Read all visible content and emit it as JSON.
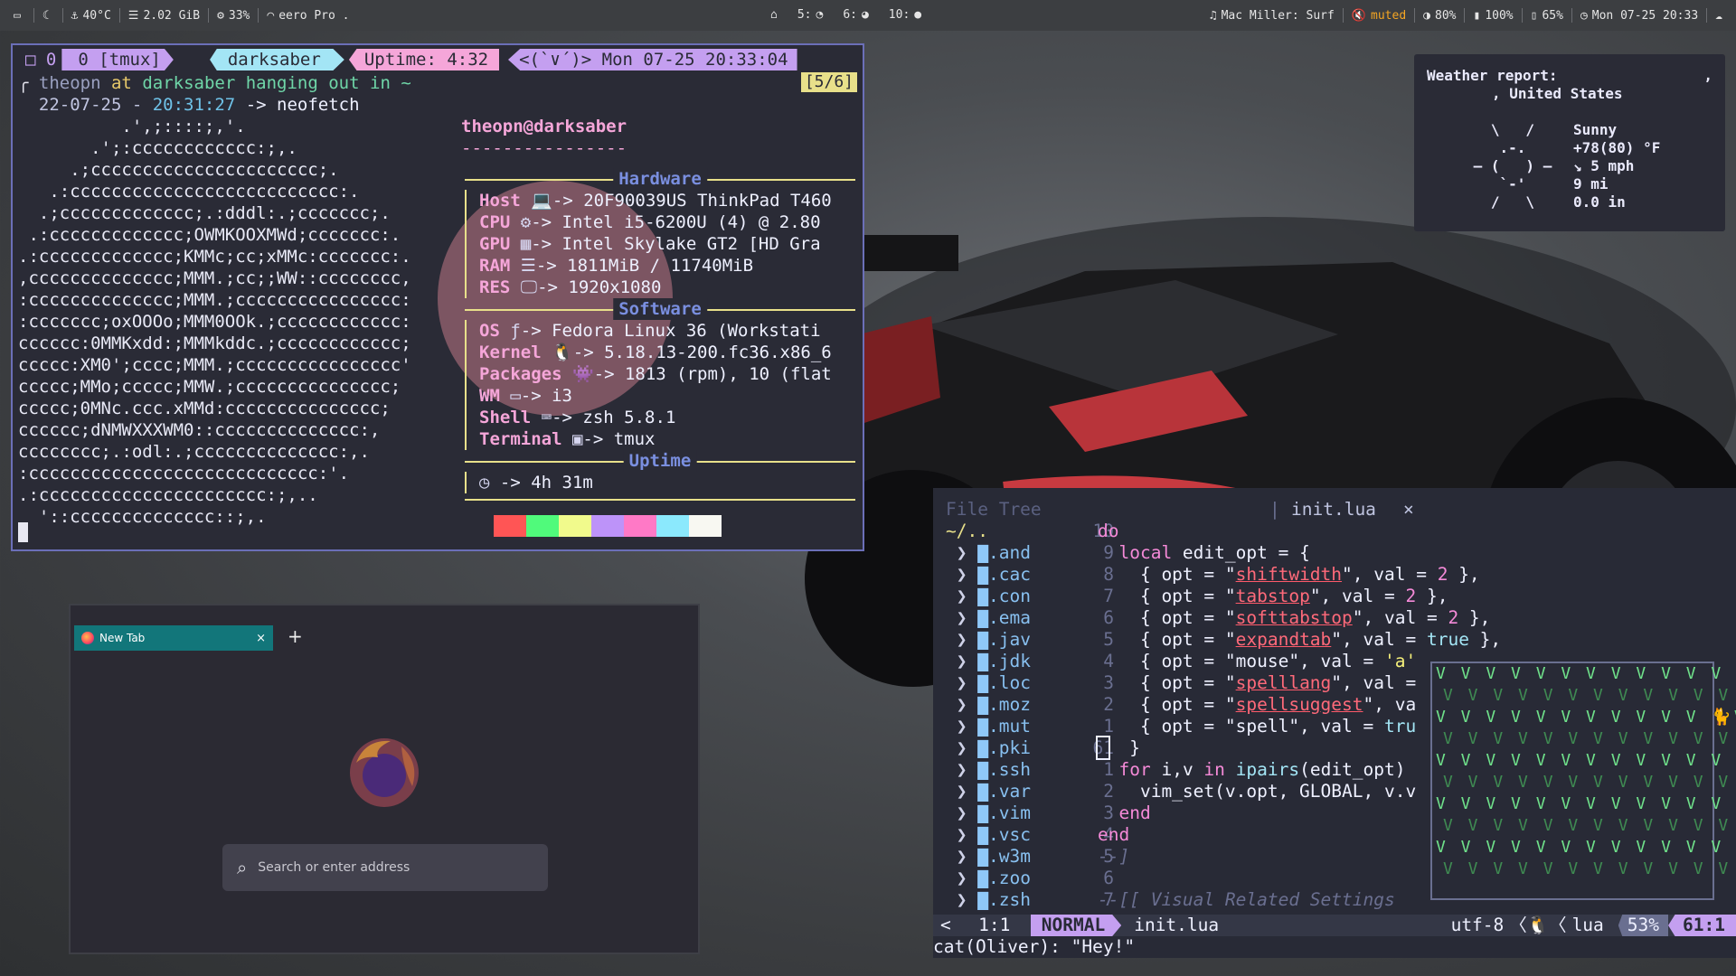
{
  "topbar": {
    "left": [
      {
        "icon": "monitor-icon",
        "text": ""
      },
      {
        "icon": "moon-icon",
        "text": ""
      },
      {
        "icon": "thermometer-icon",
        "text": "40°C"
      },
      {
        "icon": "memory-icon",
        "text": "2.02 GiB"
      },
      {
        "icon": "cpu-icon",
        "text": "33%"
      },
      {
        "icon": "wifi-icon",
        "text": "eero Pro ."
      }
    ],
    "workspaces": [
      {
        "icon": "home-icon",
        "label": ""
      },
      {
        "label": "5:",
        "icon": "clock-icon"
      },
      {
        "label": "6:",
        "icon": "browser-icon"
      },
      {
        "label": "10:",
        "icon": "chat-icon"
      }
    ],
    "music": "Mac Miller: Surf",
    "volume": "muted",
    "brightness": "80%",
    "battery1": "100%",
    "battery2": "65%",
    "datetime": "Mon 07-25 20:33"
  },
  "tmux": {
    "pane": "0",
    "window": "0 [tmux]",
    "host": "darksaber",
    "uptime_label": "Uptime:",
    "uptime": "4:32",
    "face": "<(`∨´)>",
    "date": "Mon 07-25",
    "time": "20:33:04",
    "badge": "[5/6]",
    "prompt_user": "theopn",
    "prompt_at": "at",
    "prompt_host": "darksaber",
    "prompt_hang": "hanging out in ~",
    "prompt_date": "22-07-25 -",
    "prompt_time": "20:31:27",
    "prompt_cmd": "-> neofetch",
    "ascii": "          .',;::::;,'.\n       .';:cccccccccccc:;,.\n     .;cccccccccccccccccccccc;.\n   .:cccccccccccccccccccccccccc:.\n  .;ccccccccccccc;.:dddl:.;ccccccc;.\n .:ccccccccccccc;OWMKOOXMWd;ccccccc:.\n.:ccccccccccccc;KMMc;cc;xMMc:ccccccc:.\n,cccccccccccccc;MMM.;cc;;WW::cccccccc,\n:cccccccccccccc;MMM.;cccccccccccccccc:\n:ccccccc;oxOOOo;MMM0OOk.;cccccccccccc:\ncccccc:0MMKxdd:;MMMkddc.;cccccccccccc;\nccccc:XM0';cccc;MMM.;cccccccccccccccc'\nccccc;MMo;ccccc;MMW.;ccccccccccccccc;\nccccc;0MNc.ccc.xMMd:ccccccccccccccc;\ncccccc;dNMWXXXWM0::cccccccccccccc:,\ncccccccc;.:odl:.;cccccccccccccc:,.\n:cccccccccccccccccccccccccccc:'.\n.:cccccccccccccccccccccc:;,..\n  '::cccccccccccccc::;,.",
    "nf_title": "theopn@darksaber",
    "nf_sep": "----------------",
    "hardware_label": "Hardware",
    "software_label": "Software",
    "uptime_section_label": "Uptime",
    "hardware": [
      {
        "key": "Host",
        "icon": "laptop-icon",
        "glyph": "💻",
        "val": "-> 20F90039US ThinkPad T460"
      },
      {
        "key": "CPU",
        "icon": "chip-icon",
        "glyph": "⚙",
        "val": "-> Intel i5-6200U (4) @ 2.80"
      },
      {
        "key": "GPU",
        "icon": "gpu-icon",
        "glyph": "▦",
        "val": "-> Intel Skylake GT2 [HD Gra"
      },
      {
        "key": "RAM",
        "icon": "ram-icon",
        "glyph": "☰",
        "val": "-> 1811MiB / 11740MiB"
      },
      {
        "key": "RES",
        "icon": "display-icon",
        "glyph": "🖵",
        "val": "-> 1920x1080"
      }
    ],
    "software": [
      {
        "key": "OS",
        "icon": "fedora-icon",
        "glyph": "ƒ",
        "val": "-> Fedora Linux 36 (Workstati"
      },
      {
        "key": "Kernel",
        "icon": "tux-icon",
        "glyph": "🐧",
        "val": "-> 5.18.13-200.fc36.x86_6"
      },
      {
        "key": "Packages",
        "icon": "package-icon",
        "glyph": "👾",
        "val": "-> 1813 (rpm), 10 (flat"
      },
      {
        "key": "WM",
        "icon": "window-icon",
        "glyph": "▭",
        "val": "-> i3"
      },
      {
        "key": "Shell",
        "icon": "shell-icon",
        "glyph": "⌨",
        "val": "-> zsh 5.8.1"
      },
      {
        "key": "Terminal",
        "icon": "terminal-icon",
        "glyph": "▣",
        "val": "-> tmux"
      }
    ],
    "uptime_row": {
      "icon": "clock-icon",
      "glyph": "◷",
      "val": "-> 4h 31m"
    },
    "colors": [
      "#2a2b36",
      "#ff5555",
      "#50fa7b",
      "#f1fa8c",
      "#bd93f9",
      "#ff79c6",
      "#8be9fd",
      "#f8f8f2"
    ]
  },
  "weather": {
    "title": "Weather report:",
    "comma": ",",
    "location": ", United States",
    "art": "   \\   /  \n    .-.   \n ‒ (   ) ‒\n    `-'   \n   /   \\  ",
    "condition": "Sunny",
    "temp": "+78(80) °F",
    "wind": "↘ 5 mph",
    "visibility": "9 mi",
    "precip": "0.0 in"
  },
  "firefox": {
    "tab_title": "New Tab",
    "tab_close": "×",
    "new_tab": "+",
    "search_placeholder": "Search or enter address"
  },
  "nvim": {
    "tree_title": "File Tree",
    "sep": "|",
    "buffer": "init.lua",
    "buffer_close": "×",
    "tree_root": "~/..",
    "tree": [
      ".and",
      ".cac",
      ".con",
      ".ema",
      ".jav",
      ".jdk",
      ".loc",
      ".moz",
      ".mut",
      ".pki",
      ".ssh",
      ".var",
      ".vim",
      ".vsc",
      ".w3m",
      ".zoo",
      ".zsh"
    ],
    "gutter": [
      "10",
      "9",
      "8",
      "7",
      "6",
      "5",
      "4",
      "3",
      "2",
      "1",
      "61",
      "1",
      "2",
      "3",
      "4",
      "5",
      "6",
      "7"
    ],
    "code": [
      [
        {
          "c": "kw",
          "t": "do"
        }
      ],
      [
        {
          "c": "",
          "t": "  "
        },
        {
          "c": "kw",
          "t": "local"
        },
        {
          "c": "",
          "t": " edit_opt = {"
        }
      ],
      [
        {
          "c": "",
          "t": "    { opt = \""
        },
        {
          "c": "ul",
          "t": "shiftwidth"
        },
        {
          "c": "",
          "t": "\", val = "
        },
        {
          "c": "num",
          "t": "2"
        },
        {
          "c": "",
          "t": " },"
        }
      ],
      [
        {
          "c": "",
          "t": "    { opt = \""
        },
        {
          "c": "ul",
          "t": "tabstop"
        },
        {
          "c": "",
          "t": "\", val = "
        },
        {
          "c": "num",
          "t": "2"
        },
        {
          "c": "",
          "t": " },"
        }
      ],
      [
        {
          "c": "",
          "t": "    { opt = \""
        },
        {
          "c": "ul",
          "t": "softtabstop"
        },
        {
          "c": "",
          "t": "\", val = "
        },
        {
          "c": "num",
          "t": "2"
        },
        {
          "c": "",
          "t": " },"
        }
      ],
      [
        {
          "c": "",
          "t": "    { opt = \""
        },
        {
          "c": "ul",
          "t": "expandtab"
        },
        {
          "c": "",
          "t": "\", val = "
        },
        {
          "c": "bool",
          "t": "true"
        },
        {
          "c": "",
          "t": " },"
        }
      ],
      [
        {
          "c": "",
          "t": "    { opt = \"mouse\", val = "
        },
        {
          "c": "str",
          "t": "'a'"
        }
      ],
      [
        {
          "c": "",
          "t": "    { opt = \""
        },
        {
          "c": "ul",
          "t": "spelllang"
        },
        {
          "c": "",
          "t": "\", val ="
        }
      ],
      [
        {
          "c": "",
          "t": "    { opt = \""
        },
        {
          "c": "ul",
          "t": "spellsuggest"
        },
        {
          "c": "",
          "t": "\", va"
        }
      ],
      [
        {
          "c": "",
          "t": "    { opt = \"spell\", val = "
        },
        {
          "c": "bool",
          "t": "tru"
        }
      ],
      [
        {
          "c": "",
          "t": "  }"
        }
      ],
      [
        {
          "c": "",
          "t": "  "
        },
        {
          "c": "kw",
          "t": "for"
        },
        {
          "c": "",
          "t": " i,v "
        },
        {
          "c": "kw",
          "t": "in"
        },
        {
          "c": "",
          "t": " "
        },
        {
          "c": "fn",
          "t": "ipairs"
        },
        {
          "c": "",
          "t": "(edit_opt)"
        }
      ],
      [
        {
          "c": "",
          "t": "    vim_set(v.opt, GLOBAL, v.v"
        }
      ],
      [
        {
          "c": "",
          "t": "  "
        },
        {
          "c": "kw",
          "t": "end"
        }
      ],
      [
        {
          "c": "kw",
          "t": "end"
        }
      ],
      [
        {
          "c": "cm",
          "t": "--]"
        }
      ],
      [
        {
          "c": "",
          "t": ""
        }
      ],
      [
        {
          "c": "cm",
          "t": "--[[ Visual Related Settings"
        }
      ]
    ],
    "float_rows": [
      "V V V V V V V V V V V V V",
      "V V V V V V V V V V V V",
      "V V V V V V V V V V V 🐈V",
      "V V V V V V V V V V V V",
      "V V V V V V V V V V V V V",
      "V V V V V V V V V V V V",
      "V V V V V V V V V V V V V",
      "V V V V V V V V V V V V",
      "V V V V V V V V V V V V V",
      "V V V V V V V V V V V V"
    ],
    "status": {
      "left_arrow": "<",
      "pos_left": "1:1",
      "mode": "NORMAL",
      "file": "init.lua",
      "encoding": "utf-8",
      "filetype": "lua",
      "percent": "53%",
      "pos_right": "61:1"
    },
    "cmdline": "cat(Oliver): \"Hey!\""
  }
}
